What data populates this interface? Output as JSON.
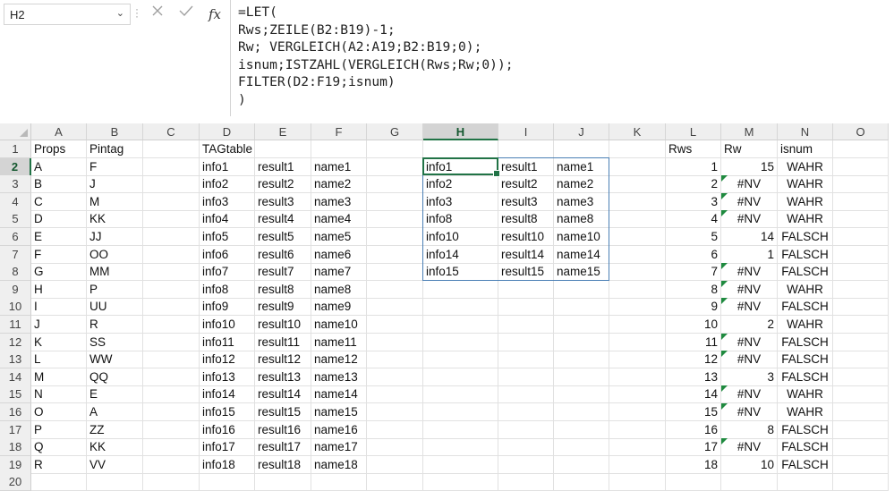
{
  "name_box": {
    "value": "H2",
    "dropdown_icon": "chevron-down-icon"
  },
  "formula_bar": {
    "cancel_icon": "cancel-x-icon",
    "enter_icon": "checkmark-icon",
    "fx_label": "fx",
    "lines": [
      "=LET(",
      "Rws;ZEILE(B2:B19)-1;",
      "Rw; VERGLEICH(A2:A19;B2:B19;0);",
      "isnum;ISTZAHL(VERGLEICH(Rws;Rw;0));",
      "FILTER(D2:F19;isnum)",
      ")"
    ]
  },
  "columns": [
    "A",
    "B",
    "C",
    "D",
    "E",
    "F",
    "G",
    "H",
    "I",
    "J",
    "K",
    "L",
    "M",
    "N",
    "O"
  ],
  "selected_column": "H",
  "rows": [
    "1",
    "2",
    "3",
    "4",
    "5",
    "6",
    "7",
    "8",
    "9",
    "10",
    "11",
    "12",
    "13",
    "14",
    "15",
    "16",
    "17",
    "18",
    "19",
    "20"
  ],
  "selected_row": "2",
  "headers_row": {
    "A": "Props",
    "B": "Pintag",
    "D": "TAGtable",
    "L": "Rws",
    "M": "Rw",
    "N": "isnum"
  },
  "props": [
    "A",
    "B",
    "C",
    "D",
    "E",
    "F",
    "G",
    "H",
    "I",
    "J",
    "K",
    "L",
    "M",
    "N",
    "O",
    "P",
    "Q",
    "R"
  ],
  "pintag": [
    "F",
    "J",
    "M",
    "KK",
    "JJ",
    "OO",
    "MM",
    "P",
    "UU",
    "R",
    "SS",
    "WW",
    "QQ",
    "E",
    "A",
    "ZZ",
    "KK",
    "VV"
  ],
  "tagtable": [
    [
      "info1",
      "result1",
      "name1"
    ],
    [
      "info2",
      "result2",
      "name2"
    ],
    [
      "info3",
      "result3",
      "name3"
    ],
    [
      "info4",
      "result4",
      "name4"
    ],
    [
      "info5",
      "result5",
      "name5"
    ],
    [
      "info6",
      "result6",
      "name6"
    ],
    [
      "info7",
      "result7",
      "name7"
    ],
    [
      "info8",
      "result8",
      "name8"
    ],
    [
      "info9",
      "result9",
      "name9"
    ],
    [
      "info10",
      "result10",
      "name10"
    ],
    [
      "info11",
      "result11",
      "name11"
    ],
    [
      "info12",
      "result12",
      "name12"
    ],
    [
      "info13",
      "result13",
      "name13"
    ],
    [
      "info14",
      "result14",
      "name14"
    ],
    [
      "info15",
      "result15",
      "name15"
    ],
    [
      "info16",
      "result16",
      "name16"
    ],
    [
      "info17",
      "result17",
      "name17"
    ],
    [
      "info18",
      "result18",
      "name18"
    ]
  ],
  "filter_result": [
    [
      "info1",
      "result1",
      "name1"
    ],
    [
      "info2",
      "result2",
      "name2"
    ],
    [
      "info3",
      "result3",
      "name3"
    ],
    [
      "info8",
      "result8",
      "name8"
    ],
    [
      "info10",
      "result10",
      "name10"
    ],
    [
      "info14",
      "result14",
      "name14"
    ],
    [
      "info15",
      "result15",
      "name15"
    ]
  ],
  "rws": [
    "1",
    "2",
    "3",
    "4",
    "5",
    "6",
    "7",
    "8",
    "9",
    "10",
    "11",
    "12",
    "13",
    "14",
    "15",
    "16",
    "17",
    "18"
  ],
  "rw": [
    "15",
    "#NV",
    "#NV",
    "#NV",
    "14",
    "1",
    "#NV",
    "#NV",
    "#NV",
    "2",
    "#NV",
    "#NV",
    "3",
    "#NV",
    "#NV",
    "8",
    "#NV",
    "10"
  ],
  "isnum": [
    "WAHR",
    "WAHR",
    "WAHR",
    "WAHR",
    "FALSCH",
    "FALSCH",
    "FALSCH",
    "WAHR",
    "FALSCH",
    "WAHR",
    "FALSCH",
    "FALSCH",
    "FALSCH",
    "WAHR",
    "WAHR",
    "FALSCH",
    "FALSCH",
    "FALSCH"
  ],
  "colors": {
    "accent": "#217346",
    "error_flag": "#1f8a3f",
    "spill_border": "#4a7fb5"
  }
}
